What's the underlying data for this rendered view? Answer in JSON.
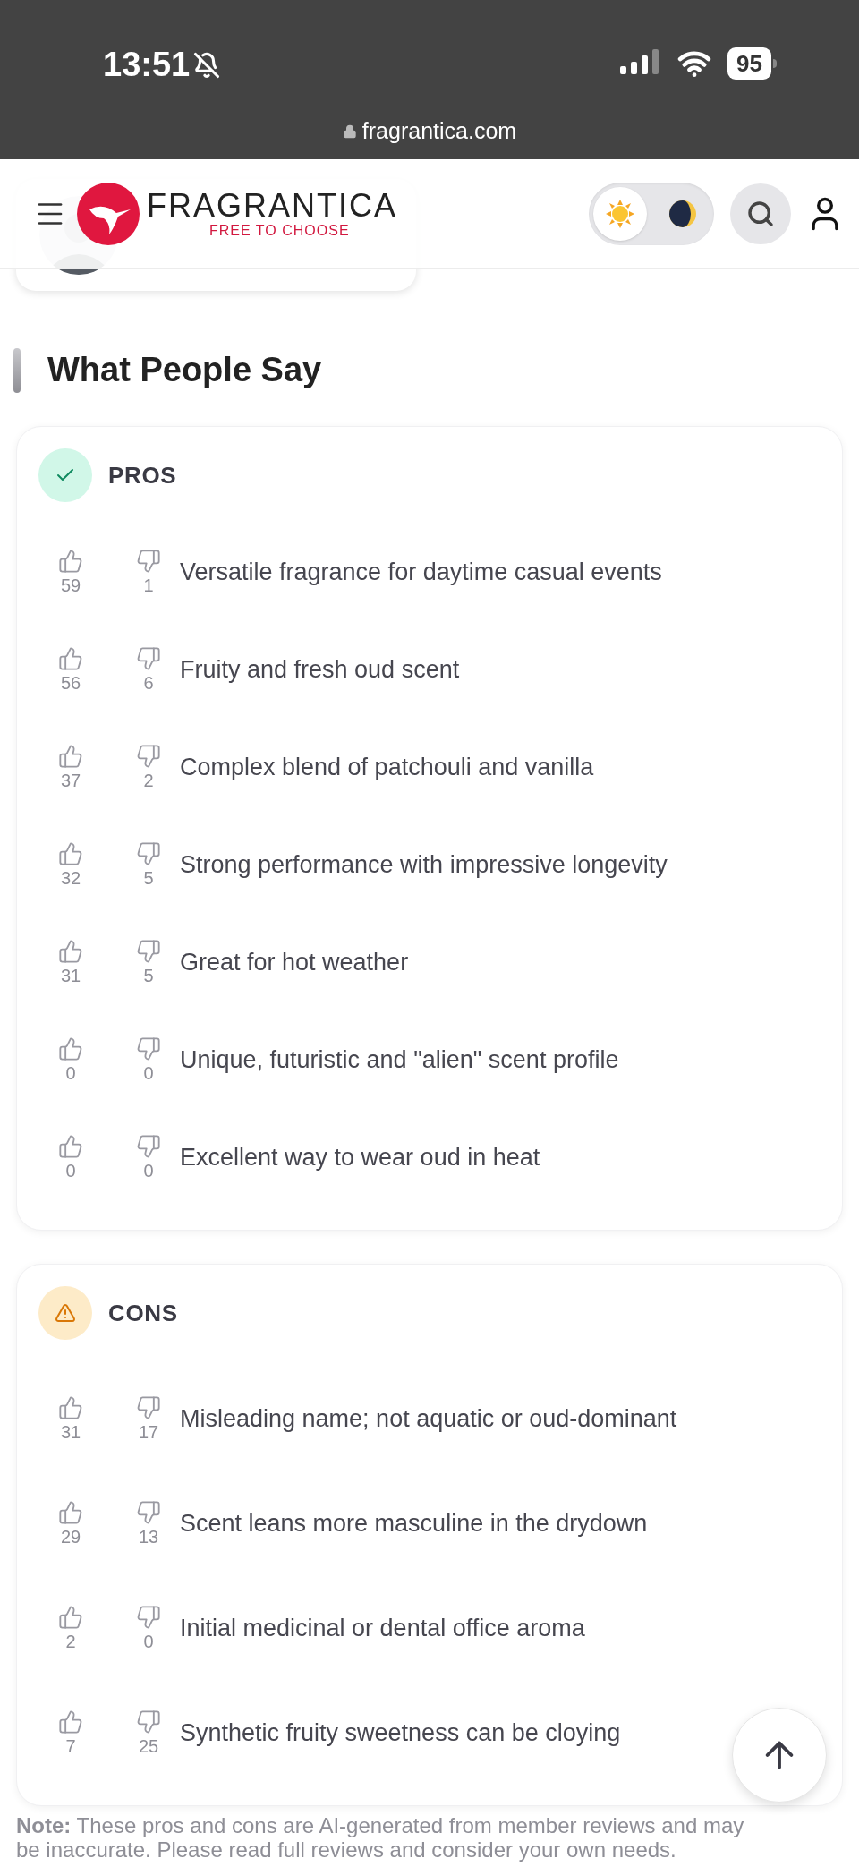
{
  "status_bar": {
    "time": "13:51",
    "battery": "95"
  },
  "address_bar": {
    "url": "fragrantica.com"
  },
  "header": {
    "logo_name": "FRAGRANTICA",
    "tagline": "FREE TO CHOOSE",
    "theme_options": [
      {
        "kind": "light",
        "selected": true
      },
      {
        "kind": "dark",
        "selected": false
      }
    ]
  },
  "section": {
    "title": "What People Say"
  },
  "groups": [
    {
      "kind": "pros",
      "title": "PROS",
      "items": [
        {
          "text": "Versatile fragrance for daytime casual events",
          "up": "59",
          "down": "1"
        },
        {
          "text": "Fruity and fresh oud scent",
          "up": "56",
          "down": "6"
        },
        {
          "text": "Complex blend of patchouli and vanilla",
          "up": "37",
          "down": "2"
        },
        {
          "text": "Strong performance with impressive longevity",
          "up": "32",
          "down": "5"
        },
        {
          "text": "Great for hot weather",
          "up": "31",
          "down": "5"
        },
        {
          "text": "Unique, futuristic and \"alien\" scent profile",
          "up": "0",
          "down": "0"
        },
        {
          "text": "Excellent way to wear oud in heat",
          "up": "0",
          "down": "0"
        }
      ]
    },
    {
      "kind": "cons",
      "title": "CONS",
      "items": [
        {
          "text": "Misleading name; not aquatic or oud-dominant",
          "up": "31",
          "down": "17"
        },
        {
          "text": "Scent leans more masculine in the drydown",
          "up": "29",
          "down": "13"
        },
        {
          "text": "Initial medicinal or dental office aroma",
          "up": "2",
          "down": "0"
        },
        {
          "text": "Synthetic fruity sweetness can be cloying",
          "up": "7",
          "down": "25"
        }
      ]
    }
  ],
  "note": "**Note:** These pros and cons are AI-generated from member reviews and may be inaccurate. Please read full reviews and consider your own needs."
}
